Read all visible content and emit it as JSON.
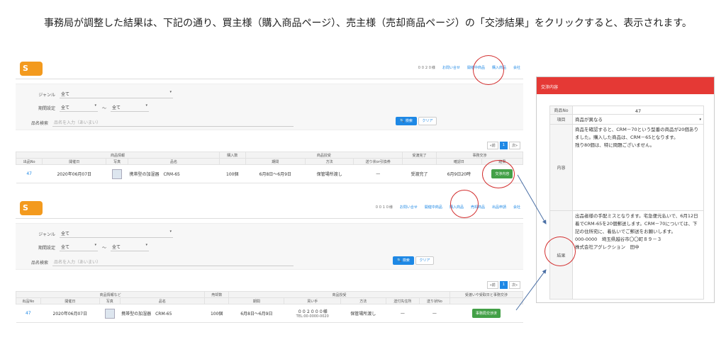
{
  "intro": "事務局が調整した結果は、下記の通り、買主様（購入商品ページ）、売主様（売却商品ページ）の「交渉結果」をクリックすると、表示されます。",
  "colors": {
    "brand_orange": "#f39a1e",
    "link_blue": "#1e88e5",
    "accent_red": "#e53935",
    "button_green": "#43a047",
    "circle_red": "#d32f2f"
  },
  "screen1": {
    "logo": "S",
    "nav": [
      "００２０様",
      "お問い合せ",
      "開催中商品",
      "購入商品",
      "会社"
    ],
    "search": {
      "genre_label": "ジャンル",
      "genre_value": "全て",
      "period_label": "期間設定",
      "period_from": "全て",
      "period_sep": "～",
      "period_to": "全て",
      "name_label": "品名検索",
      "name_placeholder": "品名を入力（あいまい）",
      "search_btn": "検索",
      "clear_btn": "クリア"
    },
    "pager": [
      "«前",
      "1",
      "次»"
    ],
    "groups": [
      "商品情報",
      "購入数",
      "商品授受",
      "受渡完了",
      "事務交渉"
    ],
    "columns": [
      "出品No",
      "開催日",
      "写真",
      "品名",
      "",
      "期間",
      "方法",
      "送り状or引換券",
      "",
      "確認日",
      "結果"
    ],
    "row": {
      "no": "47",
      "date": "2020年06月07日",
      "name": "携帯型の加湿器　CRM-65",
      "qty": "100個",
      "period": "6月8日～6月9日",
      "method": "保管場所渡し",
      "ticket": "—",
      "done": "受渡完了",
      "confirm": "6月9日20時",
      "result_btn": "交渉内容"
    }
  },
  "screen2": {
    "logo": "S",
    "nav": [
      "００１０様",
      "お問い合せ",
      "開催中商品",
      "購入商品",
      "売却商品",
      "出品申請",
      "会社"
    ],
    "search": {
      "genre_label": "ジャンル",
      "genre_value": "全て",
      "period_label": "期間設定",
      "period_from": "全て",
      "period_sep": "～",
      "period_to": "全て",
      "name_label": "品名検索",
      "name_placeholder": "品名を入力（あいまい）",
      "search_btn": "検索",
      "clear_btn": "クリア"
    },
    "pager": [
      "«前",
      "1",
      "次»"
    ],
    "groups": [
      "商品情報など",
      "売却数",
      "商品授受",
      "受渡いや受取日と事務交渉"
    ],
    "columns": [
      "出品No",
      "開催日",
      "写真",
      "品名",
      "",
      "期間",
      "買い手",
      "方法",
      "送付先住所",
      "送り状No",
      ""
    ],
    "row": {
      "no": "47",
      "date": "2020年06月07日",
      "name": "携帯型の加湿器　CRM-65",
      "qty": "100個",
      "period": "6月8日～6月9日",
      "buyer": "００２０００様",
      "buyer_tel": "TEL:00-0000-0020",
      "method": "保管場所渡し",
      "addr": "—",
      "slip": "—",
      "result_btn": "事務局交渉済"
    }
  },
  "modal": {
    "title": "交渉内容",
    "no_label": "商品No",
    "no_value": "47",
    "item_label": "項目",
    "item_value": "商品が異なる",
    "content_label": "内容",
    "content_text": "商品を確認すると、CRM－70という型番の商品が20個ありました。購入した商品は、CRM－65となります。\n残り80個は、特に問題ございません。",
    "result_label": "結果",
    "result_text": "出品者様の手配ミスとなります。宅急便元払いで、6月12日着でCRM-65を20個郵送します。CRM－70については、下記の住所宛に、着払いでご郵送をお願いします。\n000-0000　埼玉県越谷市〇〇町８９－３\n株式会社アグレクション　田中"
  }
}
